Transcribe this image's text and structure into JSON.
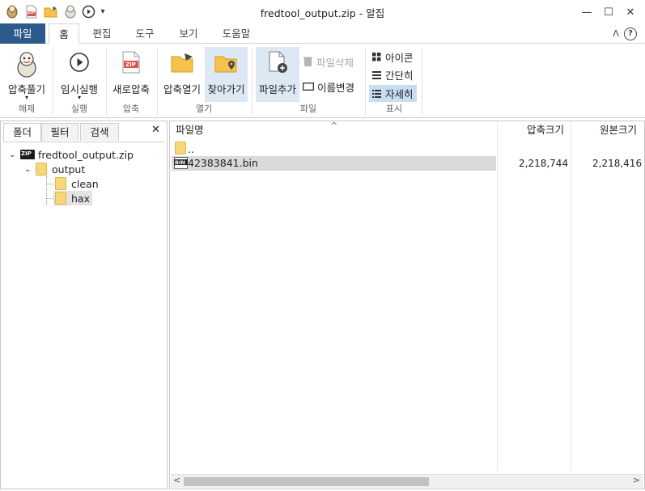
{
  "window": {
    "title": "fredtool_output.zip - 알집",
    "minimize_glyph": "—",
    "maximize_glyph": "☐",
    "close_glyph": "✕"
  },
  "quick_access": {
    "zip_badge": "ZIP",
    "dropdown_glyph": "▾"
  },
  "ribbon_tabs": [
    "파일",
    "홈",
    "편집",
    "도구",
    "보기",
    "도움말"
  ],
  "ribbon_right": {
    "collapse_glyph": "ᐱ",
    "help_glyph": "?"
  },
  "ribbon": {
    "extract_label": "압축풀기",
    "temp_run_label": "임시실행",
    "new_compress_label": "새로압축",
    "open_archive_label": "압축열기",
    "browse_label": "찾아가기",
    "add_file_label": "파일추가",
    "delete_file_label": "파일삭제",
    "rename_label": "이름변경",
    "view_icon_label": "아이콘",
    "view_simple_label": "간단히",
    "view_detail_label": "자세히",
    "zip_badge": "ZIP",
    "dropdown_glyph": "▾",
    "groups": {
      "extract": "해제",
      "run": "실행",
      "compress": "압축",
      "open": "열기",
      "file": "파일",
      "display": "표시"
    }
  },
  "left_panel": {
    "tabs": [
      "폴더",
      "필터",
      "검색"
    ],
    "close_glyph": "✕",
    "zip_badge": "ZIP",
    "tree": {
      "root": "fredtool_output.zip",
      "output": "output",
      "clean": "clean",
      "hax": "hax"
    },
    "expand_glyph": "⌄"
  },
  "file_list": {
    "columns": {
      "name": "파일명",
      "compressed": "압축크기",
      "original": "원본크기"
    },
    "sort_glyph": "^",
    "parent_row": "..",
    "bin_badge": "BIN",
    "rows": [
      {
        "name": "42383841.bin",
        "compressed": "2,218,744",
        "original": "2,218,416"
      }
    ],
    "scroll_left_glyph": "<",
    "scroll_right_glyph": ">"
  },
  "colors": {
    "file_tab": "#2d5a8c",
    "selection": "#dde8f5",
    "folder": "#f6d77b"
  }
}
